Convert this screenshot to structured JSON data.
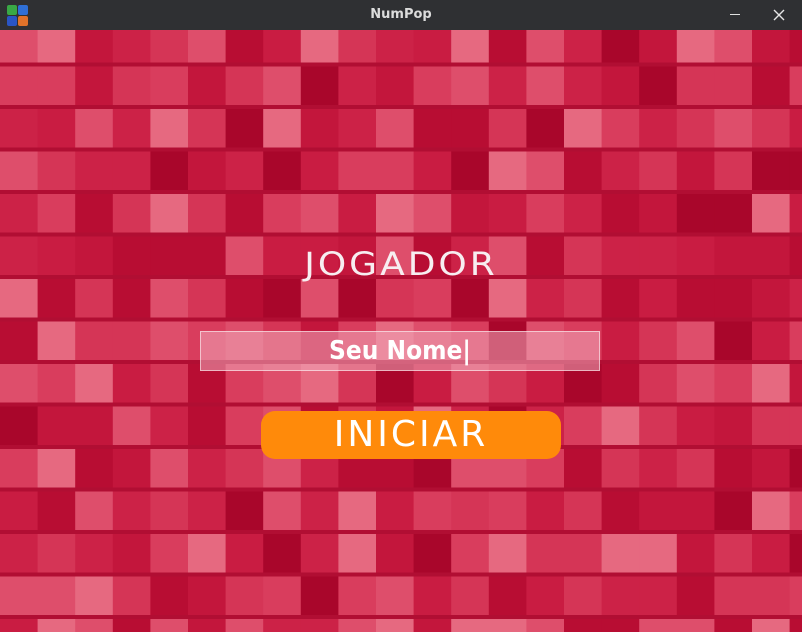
{
  "window": {
    "title": "NumPop",
    "minimize_label": "–",
    "close_label": "✕"
  },
  "screen": {
    "heading": "JOGADOR",
    "name_input": {
      "value": "",
      "placeholder": "Seu Nome|"
    },
    "start_button": "INICIAR"
  },
  "colors": {
    "background": "#c3143c",
    "button": "#ff8a0a",
    "text": "#ffffff",
    "titlebar": "#2f3033"
  },
  "icons": {
    "app": "numpop-app-icon",
    "minimize": "minimize-icon",
    "close": "close-icon"
  }
}
